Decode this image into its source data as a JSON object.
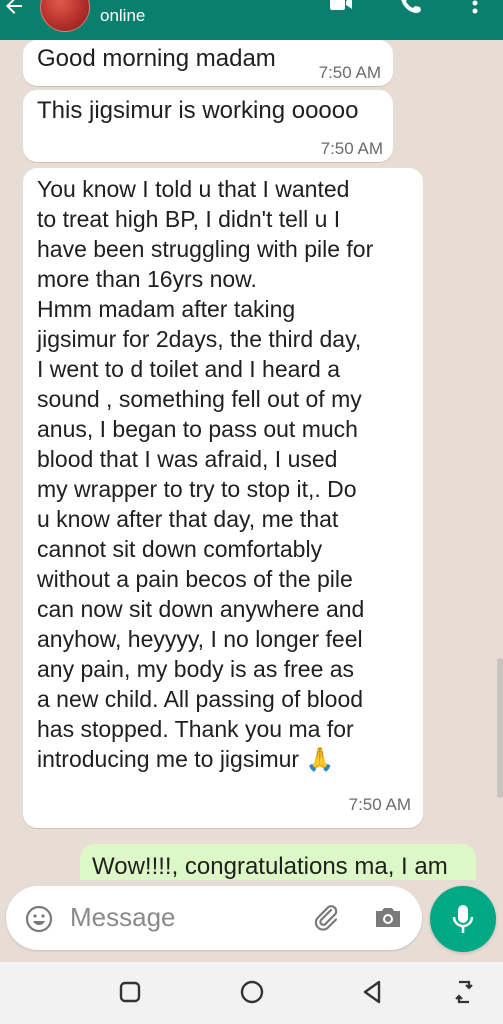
{
  "header": {
    "status": "online"
  },
  "messages": [
    {
      "text": "Good morning madam",
      "time": "7:50 AM",
      "direction": "incoming"
    },
    {
      "text": "This jigsimur is working ooooo",
      "time": "7:50 AM",
      "direction": "incoming"
    },
    {
      "lines": [
        "You know I told u that I wanted",
        "to treat high BP, I didn't tell u I",
        "have been struggling with pile for",
        "more than 16yrs now.",
        "Hmm madam after taking",
        "jigsimur for 2days, the third day,",
        "I went to d toilet and I heard a",
        "sound , something fell out of my",
        "anus, I began to pass out much",
        "blood that I was afraid, I used",
        "my wrapper to try to stop it,. Do",
        "u know after that day, me that",
        "cannot sit down comfortably",
        "without a pain becos of the pile",
        "can now sit down anywhere and",
        "anyhow, heyyyy, I no longer feel",
        "any pain, my body is as free as",
        "a new child. All passing of blood",
        "has stopped. Thank you ma for",
        "introducing me to jigsimur 🙏"
      ],
      "time": "7:50 AM",
      "direction": "incoming"
    },
    {
      "text": "Wow!!!!, congratulations ma, I am",
      "direction": "outgoing"
    }
  ],
  "composer": {
    "placeholder": "Message"
  },
  "colors": {
    "header": "#0a7f6e",
    "chat_background": "#e7ddd4",
    "incoming_bubble": "#ffffff",
    "outgoing_bubble": "#dcf8c6",
    "accent": "#00a884"
  },
  "icons": {
    "header": [
      "back-arrow-icon",
      "avatar",
      "video-call-icon",
      "phone-icon",
      "more-options-icon"
    ],
    "composer": [
      "emoji-icon",
      "attach-icon",
      "camera-icon",
      "mic-icon"
    ],
    "navbar": [
      "recents-icon",
      "home-icon",
      "back-icon",
      "rotate-icon"
    ]
  }
}
